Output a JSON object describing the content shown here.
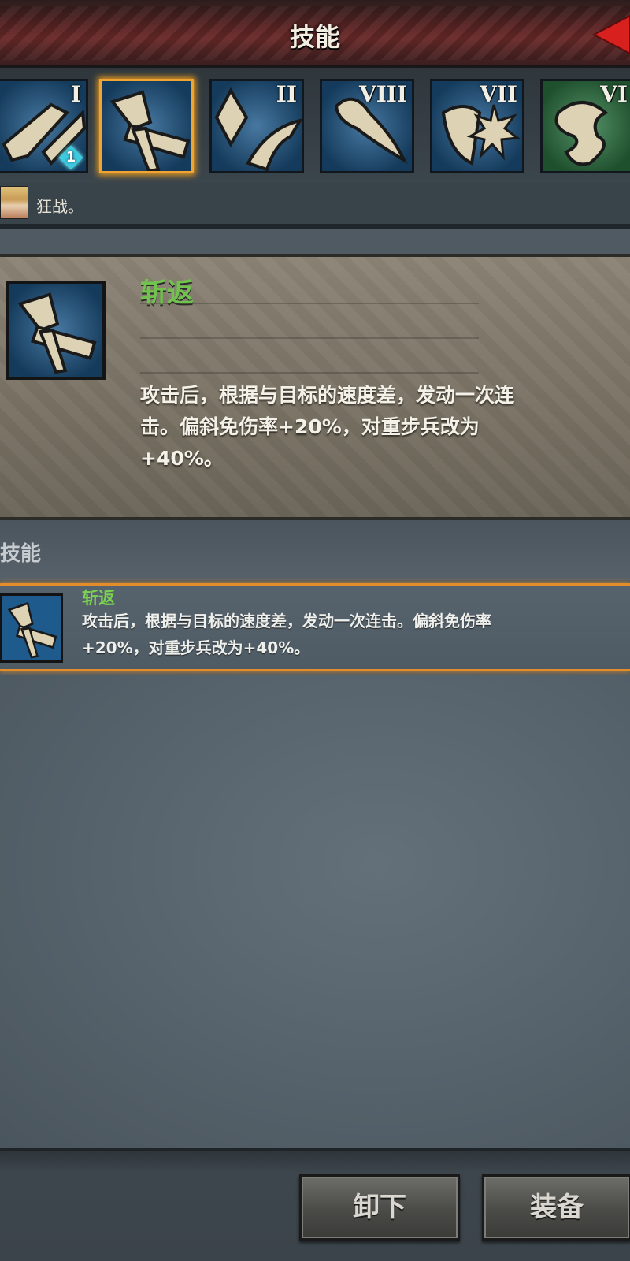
{
  "header": {
    "title": "技能",
    "close_icon": "red-arrow-close-icon"
  },
  "skill_slots": [
    {
      "id": "slot-1",
      "rank": "I",
      "level_badge": "1",
      "color": "blue",
      "selected": false
    },
    {
      "id": "slot-2",
      "rank": "",
      "color": "blue",
      "selected": true
    },
    {
      "id": "slot-3",
      "rank": "II",
      "color": "blue",
      "selected": false
    },
    {
      "id": "slot-4",
      "rank": "VIII",
      "color": "blue",
      "selected": false
    },
    {
      "id": "slot-5",
      "rank": "VII",
      "color": "blue",
      "selected": false
    },
    {
      "id": "slot-6",
      "rank": "VI",
      "color": "green",
      "selected": false
    }
  ],
  "hero": {
    "text": "狂战。"
  },
  "detail": {
    "name": "斩返",
    "description": "攻击后，根据与目标的速度差，发动一次连击。偏斜免伤率+20%，对重步兵改为+40%。"
  },
  "section": {
    "title": "技能"
  },
  "skill_list": [
    {
      "name": "斩返",
      "description": "攻击后，根据与目标的速度差，发动一次连击。偏斜免伤率+20%，对重步兵改为+40%。"
    }
  ],
  "buttons": {
    "unequip": "卸下",
    "equip": "装备"
  },
  "colors": {
    "skill_name_green": "#72c24e",
    "selected_border": "#f1a431",
    "slot_blue": "#1f5a8c",
    "slot_green": "#2f7a46",
    "header_red": "#6a2a2a",
    "close_arrow": "#d8201e"
  }
}
